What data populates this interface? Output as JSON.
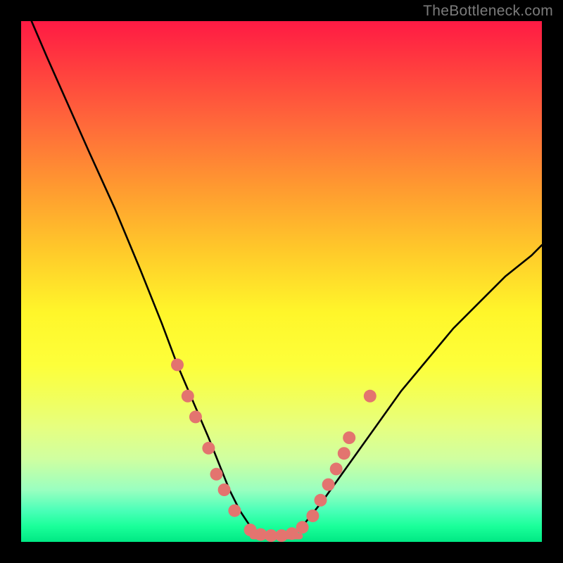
{
  "watermark": "TheBottleneck.com",
  "colors": {
    "curve": "#000000",
    "marker_fill": "#e3746f",
    "marker_stroke": "#c9544f",
    "frame": "#000000"
  },
  "chart_data": {
    "type": "line",
    "title": "",
    "xlabel": "",
    "ylabel": "",
    "xlim": [
      0,
      100
    ],
    "ylim": [
      0,
      100
    ],
    "series": [
      {
        "name": "bottleneck-curve",
        "x": [
          2,
          5,
          9,
          13,
          18,
          23,
          27,
          30,
          33,
          36,
          38,
          40,
          42,
          44,
          46,
          48,
          50,
          52,
          54,
          58,
          63,
          68,
          73,
          78,
          83,
          88,
          93,
          98,
          100
        ],
        "y": [
          100,
          93,
          84,
          75,
          64,
          52,
          42,
          34,
          27,
          20,
          15,
          10,
          6,
          3,
          1.5,
          1,
          1,
          1.5,
          3,
          8,
          15,
          22,
          29,
          35,
          41,
          46,
          51,
          55,
          57
        ]
      }
    ],
    "markers": {
      "name": "highlighted-points",
      "points": [
        {
          "x": 30,
          "y": 34
        },
        {
          "x": 32,
          "y": 28
        },
        {
          "x": 33.5,
          "y": 24
        },
        {
          "x": 36,
          "y": 18
        },
        {
          "x": 37.5,
          "y": 13
        },
        {
          "x": 39,
          "y": 10
        },
        {
          "x": 41,
          "y": 6
        },
        {
          "x": 44,
          "y": 2.3
        },
        {
          "x": 46,
          "y": 1.4
        },
        {
          "x": 48,
          "y": 1.2
        },
        {
          "x": 50,
          "y": 1.2
        },
        {
          "x": 52,
          "y": 1.6
        },
        {
          "x": 54,
          "y": 2.8
        },
        {
          "x": 56,
          "y": 5
        },
        {
          "x": 57.5,
          "y": 8
        },
        {
          "x": 59,
          "y": 11
        },
        {
          "x": 60.5,
          "y": 14
        },
        {
          "x": 62,
          "y": 17
        },
        {
          "x": 63,
          "y": 20
        },
        {
          "x": 67,
          "y": 28
        }
      ]
    },
    "gradient_stops": [
      {
        "pos": 0,
        "color": "#ff1a44"
      },
      {
        "pos": 50,
        "color": "#fff62a"
      },
      {
        "pos": 100,
        "color": "#00e884"
      }
    ]
  }
}
